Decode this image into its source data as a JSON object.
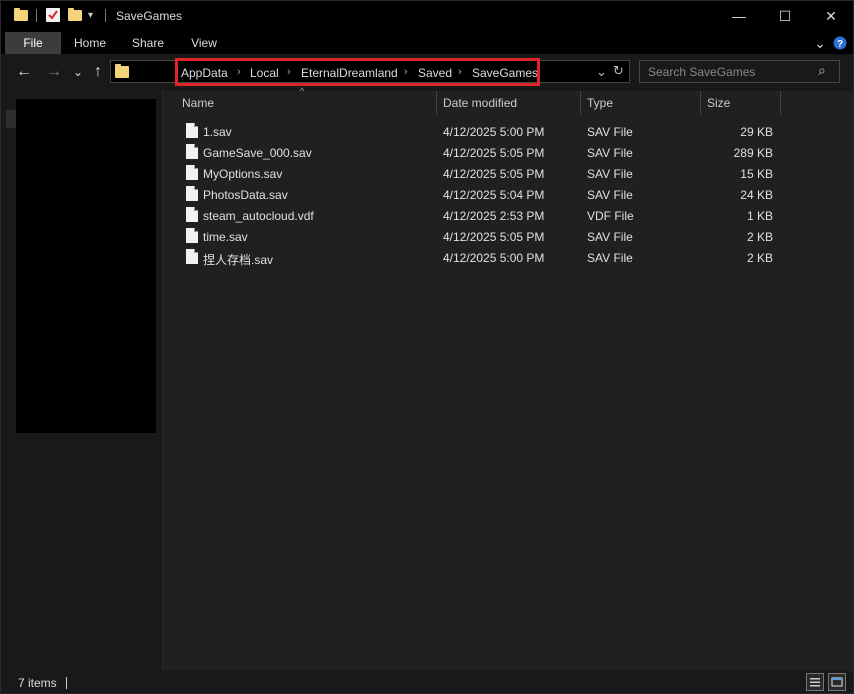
{
  "window": {
    "title": "SaveGames",
    "controls": {
      "minimize": "—",
      "maximize": "☐",
      "close": "✕"
    }
  },
  "ribbon": {
    "tabs": [
      "File",
      "Home",
      "Share",
      "View"
    ],
    "expand_glyph": "⌄",
    "help_glyph": "?"
  },
  "nav": {
    "back": "←",
    "forward": "→",
    "recent": "⌄",
    "up": "↑"
  },
  "address": {
    "crumbs": [
      "AppData",
      "Local",
      "EternalDreamland",
      "Saved",
      "SaveGames"
    ],
    "separator": "›",
    "dropdown_glyph": "⌄",
    "refresh_glyph": "↻"
  },
  "search": {
    "placeholder": "Search SaveGames",
    "icon_glyph": "⌕"
  },
  "columns": {
    "name": "Name",
    "date": "Date modified",
    "type": "Type",
    "size": "Size",
    "sort_glyph": "^"
  },
  "files": [
    {
      "name": "1.sav",
      "date": "4/12/2025 5:00 PM",
      "type": "SAV File",
      "size": "29 KB"
    },
    {
      "name": "GameSave_000.sav",
      "date": "4/12/2025 5:05 PM",
      "type": "SAV File",
      "size": "289 KB"
    },
    {
      "name": "MyOptions.sav",
      "date": "4/12/2025 5:05 PM",
      "type": "SAV File",
      "size": "15 KB"
    },
    {
      "name": "PhotosData.sav",
      "date": "4/12/2025 5:04 PM",
      "type": "SAV File",
      "size": "24 KB"
    },
    {
      "name": "steam_autocloud.vdf",
      "date": "4/12/2025 2:53 PM",
      "type": "VDF File",
      "size": "1 KB"
    },
    {
      "name": "time.sav",
      "date": "4/12/2025 5:05 PM",
      "type": "SAV File",
      "size": "2 KB"
    },
    {
      "name": "捏人存档.sav",
      "date": "4/12/2025 5:00 PM",
      "type": "SAV File",
      "size": "2 KB"
    }
  ],
  "status": {
    "items": "7 items"
  },
  "colors": {
    "highlight_box": "#e0242c",
    "folder": "#f4d37b"
  }
}
